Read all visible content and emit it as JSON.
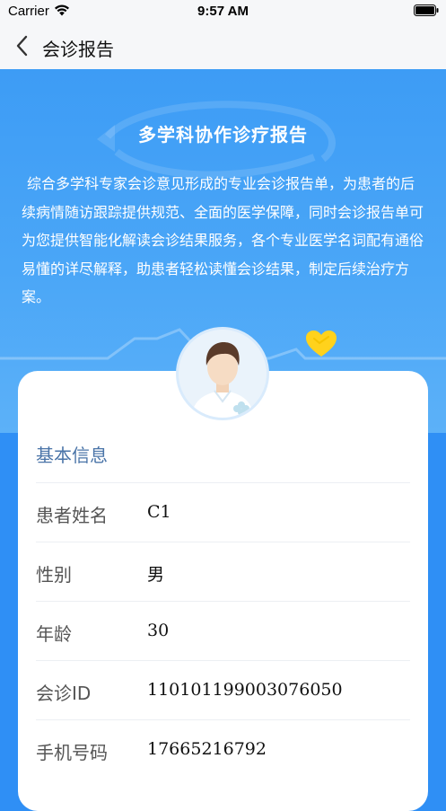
{
  "status_bar": {
    "carrier": "Carrier",
    "time": "9:57 AM"
  },
  "nav": {
    "title": "会诊报告"
  },
  "hero": {
    "title": "多学科协作诊疗报告",
    "description": "综合多学科专家会诊意见形成的专业会诊报告单，为患者的后续病情随访跟踪提供规范、全面的医学保障，同时会诊报告单可为您提供智能化解读会诊结果服务，各个专业医学名词配有通俗易懂的详尽解释，助患者轻松读懂会诊结果，制定后续治疗方案。"
  },
  "colors": {
    "primary": "#2f8ff5",
    "hero_top": "#3d9cf5",
    "heart": "#ffd21c",
    "section_header": "#4a74a8"
  },
  "basic_info": {
    "header": "基本信息",
    "rows": [
      {
        "label": "患者姓名",
        "value": "C1"
      },
      {
        "label": "性别",
        "value": "男"
      },
      {
        "label": "年龄",
        "value": "30"
      },
      {
        "label": "会诊ID",
        "value": "110101199003076050"
      },
      {
        "label": "手机号码",
        "value": "17665216792"
      }
    ]
  }
}
